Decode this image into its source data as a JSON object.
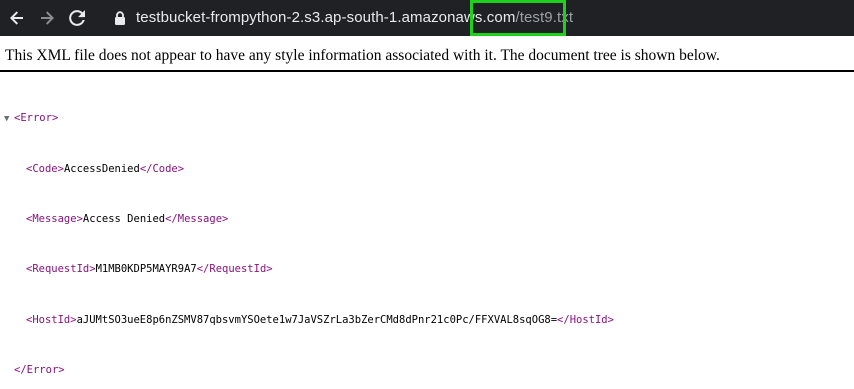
{
  "browser": {
    "url_host": "testbucket-frompython-2.s3.ap-south-1.amazonaws.com",
    "url_path": "/test9.txt",
    "highlight_color": "#1fd01f",
    "icons": [
      "back-arrow-icon",
      "forward-arrow-icon",
      "reload-icon",
      "lock-icon"
    ]
  },
  "viewer": {
    "notice": "This XML file does not appear to have any style information associated with it. The document tree is shown below.",
    "fold_glyph": "▼"
  },
  "xml": {
    "root_tag": "Error",
    "children": [
      {
        "tag": "Code",
        "value": "AccessDenied"
      },
      {
        "tag": "Message",
        "value": "Access Denied"
      },
      {
        "tag": "RequestId",
        "value": "M1MB0KDP5MAYR9A7"
      },
      {
        "tag": "HostId",
        "value": "aJUMtSO3ueE8p6nZSMV87qbsvmYSOete1w7JaVSZrLa3bZerCMd8dPnr21c0Pc/FFXVAL8sqOG8="
      }
    ]
  }
}
